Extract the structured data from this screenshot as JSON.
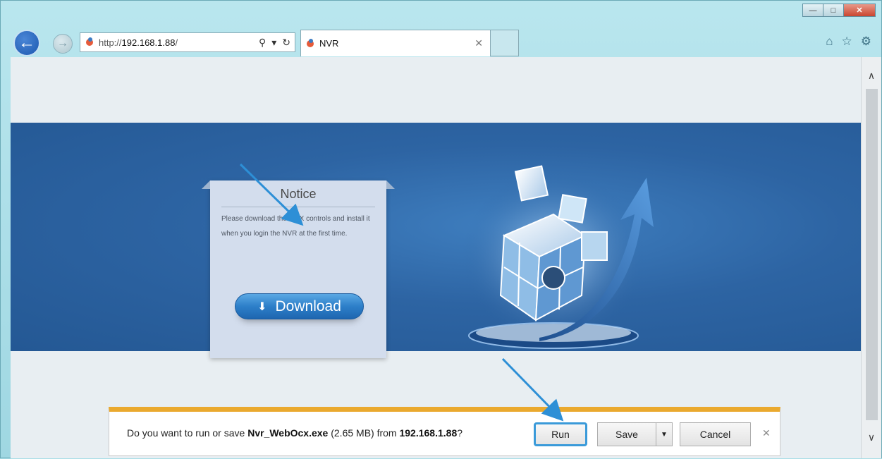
{
  "window": {
    "minimize_glyph": "—",
    "maximize_glyph": "□",
    "close_glyph": "✕"
  },
  "nav": {
    "back_glyph": "←",
    "forward_glyph": "→"
  },
  "address_bar": {
    "url_prefix": "http://",
    "url_host": "192.168.1.88",
    "url_tail": "/",
    "search_glyph": "⚲",
    "dropdown_glyph": "▾",
    "refresh_glyph": "↻"
  },
  "tab": {
    "title": "NVR",
    "close_glyph": "✕"
  },
  "toolbar": {
    "home_glyph": "⌂",
    "favorites_glyph": "☆",
    "settings_glyph": "⚙"
  },
  "scrollbar": {
    "up_glyph": "∧",
    "down_glyph": "∨"
  },
  "notice": {
    "title": "Notice",
    "text": "Please download the OCX controls and install it when you login the NVR at the first time.",
    "download_label": "Download",
    "download_glyph": "⬇"
  },
  "download_bar": {
    "prompt_start": "Do you want to run or save ",
    "file_name": "Nvr_WebOcx.exe",
    "file_size": " (2.65 MB) from ",
    "source_host": "192.168.1.88",
    "prompt_end": "?",
    "run_label": "Run",
    "save_label": "Save",
    "save_dropdown_glyph": "▼",
    "cancel_label": "Cancel",
    "close_glyph": "✕"
  },
  "colors": {
    "banner_blue": "#2d64a3",
    "download_bar_accent": "#eaa92e",
    "annotation_arrow": "#2d8fd6"
  },
  "icons": [
    "back-icon",
    "forward-icon",
    "site-favicon",
    "search-icon",
    "refresh-icon",
    "home-icon",
    "favorites-icon",
    "settings-icon",
    "download-icon",
    "close-icon"
  ]
}
